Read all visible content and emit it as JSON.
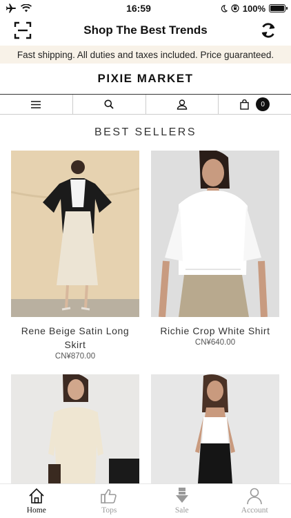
{
  "status_bar": {
    "time": "16:59",
    "battery": "100%"
  },
  "header": {
    "title": "Shop The Best Trends"
  },
  "promo": {
    "text": "Fast shipping. All duties and taxes included. Price guaranteed."
  },
  "store": {
    "logo": "PIXIE MARKET",
    "cart_count": "0"
  },
  "section": {
    "title": "BEST SELLERS"
  },
  "products": [
    {
      "name": "Rene Beige Satin Long Skirt",
      "price": "CN¥870.00"
    },
    {
      "name": "Richie Crop White Shirt",
      "price": "CN¥640.00"
    },
    {
      "name": "",
      "price": ""
    },
    {
      "name": "",
      "price": ""
    }
  ],
  "tabs": [
    {
      "label": "Home",
      "icon": "home-icon",
      "active": true
    },
    {
      "label": "Tops",
      "icon": "thumbs-up-icon",
      "active": false
    },
    {
      "label": "Sale",
      "icon": "sale-tag-icon",
      "active": false
    },
    {
      "label": "Account",
      "icon": "person-icon",
      "active": false
    }
  ],
  "colors": {
    "promo_bg": "#f8f2e8",
    "inactive_tab": "#999999",
    "active_tab": "#111111"
  }
}
